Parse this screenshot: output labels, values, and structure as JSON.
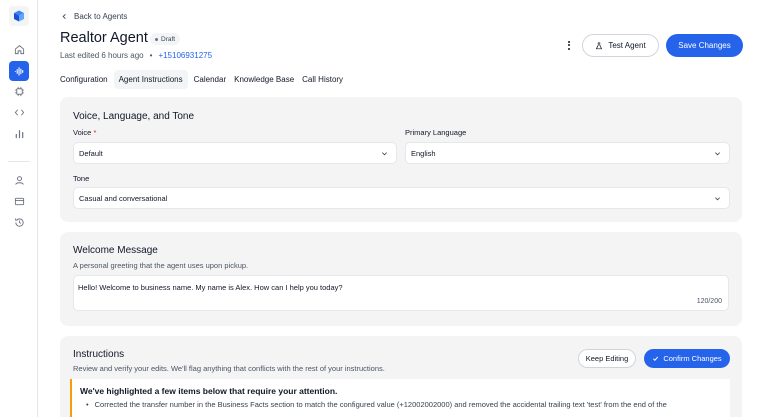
{
  "sidebar": {
    "logo": "cube-logo-icon",
    "items": [
      {
        "icon": "home-icon",
        "active": false
      },
      {
        "icon": "audio-waveform-icon",
        "active": true
      },
      {
        "icon": "cpu-chip-icon",
        "active": false
      },
      {
        "icon": "code-icon",
        "active": false
      },
      {
        "icon": "bar-chart-icon",
        "active": false
      },
      {
        "icon": "user-icon",
        "active": false
      },
      {
        "icon": "credit-card-icon",
        "active": false
      },
      {
        "icon": "history-icon",
        "active": false
      }
    ],
    "accent": "#2563eb"
  },
  "header": {
    "back_label": "Back to Agents",
    "title": "Realtor Agent",
    "status_badge": "Draft",
    "last_edited": "Last edited 6 hours ago",
    "separator": "•",
    "phone": "+15106931275",
    "test_button": "Test Agent",
    "save_button": "Save Changes"
  },
  "tabs": [
    {
      "label": "Configuration",
      "active": false
    },
    {
      "label": "Agent Instructions",
      "active": true
    },
    {
      "label": "Calendar",
      "active": false
    },
    {
      "label": "Knowledge Base",
      "active": false
    },
    {
      "label": "Call History",
      "active": false
    }
  ],
  "voice_section": {
    "title": "Voice, Language, and Tone",
    "voice_label": "Voice",
    "required_mark": "*",
    "voice_value": "Default",
    "language_label": "Primary Language",
    "language_value": "English",
    "tone_label": "Tone",
    "tone_value": "Casual and conversational"
  },
  "welcome_section": {
    "title": "Welcome Message",
    "subtitle": "A personal greeting that the agent uses upon pickup.",
    "message": "Hello! Welcome to business name. My name is Alex. How can I help you today?",
    "counter": "120/200"
  },
  "instructions_section": {
    "title": "Instructions",
    "subtitle": "Review and verify your edits. We'll flag anything that conflicts with the rest of your instructions.",
    "keep_editing_button": "Keep Editing",
    "confirm_button": "Confirm Changes",
    "alert_title": "We've highlighted a few items below that require your attention.",
    "alert_bullet": "•",
    "alert_item": "Corrected the transfer number in the Business Facts section to match the configured value (+12002002000) and removed the accidental trailing text 'test' from the end of the",
    "alert_color": "#f59e0b"
  }
}
